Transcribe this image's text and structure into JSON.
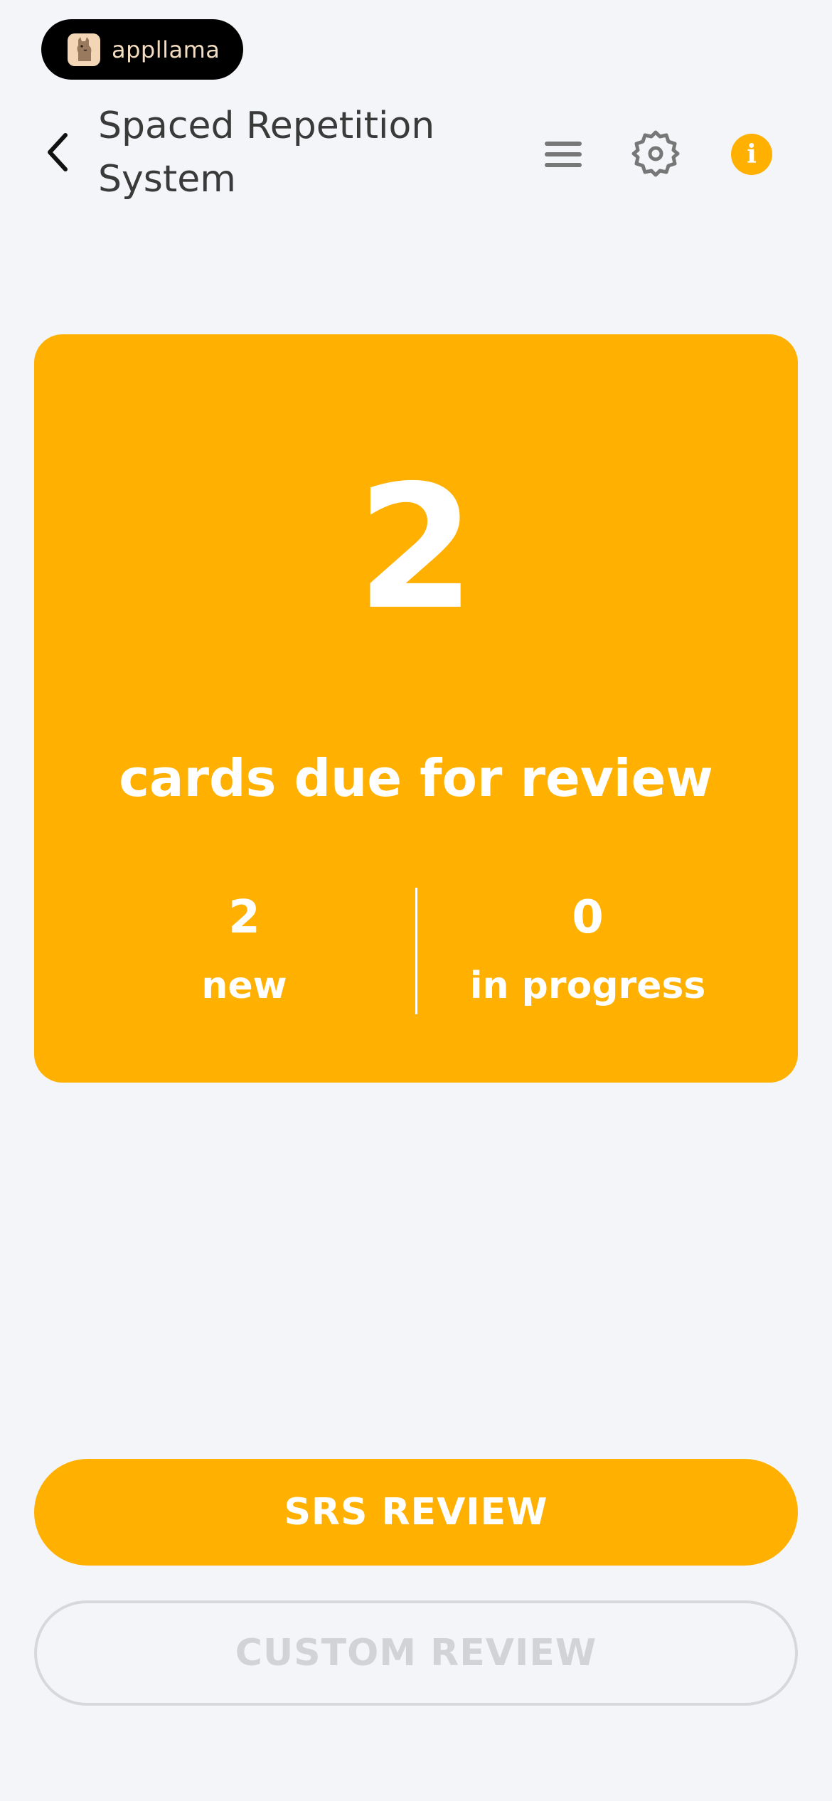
{
  "brand": {
    "name": "appllama",
    "logo_icon": "llama-logo-icon"
  },
  "header": {
    "title": "Spaced Repetition System",
    "back_icon": "chevron-left-icon",
    "menu_icon": "hamburger-menu-icon",
    "settings_icon": "gear-icon",
    "info_icon": "info-icon",
    "info_symbol": "i"
  },
  "summary": {
    "due_count": "2",
    "due_label": "cards due for review",
    "new_count": "2",
    "new_label": "new",
    "in_progress_count": "0",
    "in_progress_label": "in progress"
  },
  "actions": {
    "srs_review_label": "SRS REVIEW",
    "custom_review_label": "CUSTOM REVIEW"
  },
  "colors": {
    "accent": "#ffb000",
    "background": "#f4f5f8",
    "disabled": "#d2d3d6"
  }
}
